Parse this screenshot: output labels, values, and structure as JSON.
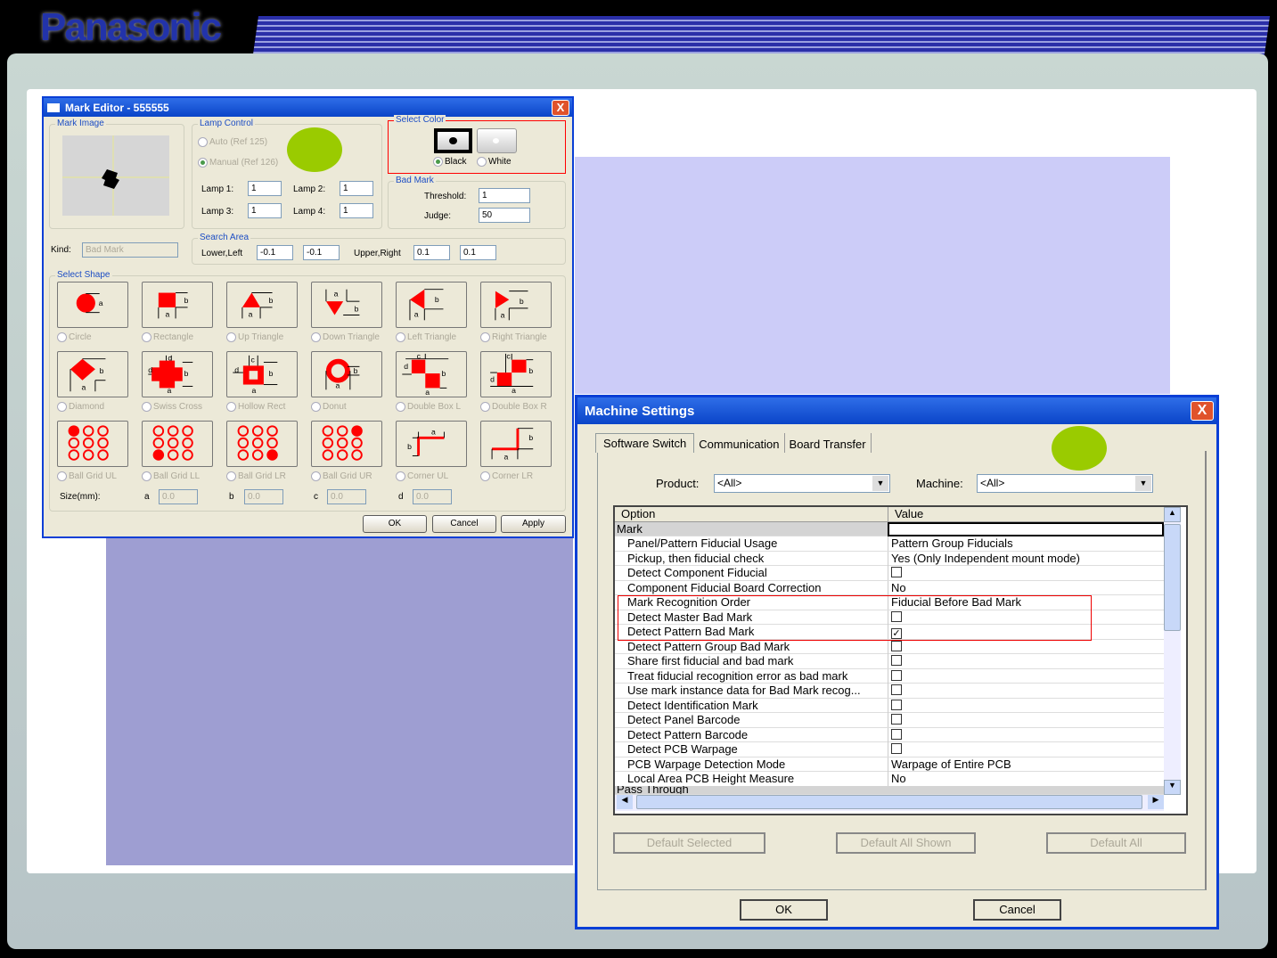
{
  "brand": "Panasonic",
  "mark_editor": {
    "title": "Mark Editor - 555555",
    "close": "X",
    "mark_image_label": "Mark Image",
    "lamp_control": {
      "label": "Lamp Control",
      "auto": "Auto (Ref 125)",
      "manual": "Manual (Ref 126)",
      "lamps": [
        {
          "label": "Lamp 1:",
          "value": "1"
        },
        {
          "label": "Lamp 2:",
          "value": "1"
        },
        {
          "label": "Lamp 3:",
          "value": "1"
        },
        {
          "label": "Lamp 4:",
          "value": "1"
        }
      ]
    },
    "select_color": {
      "label": "Select Color",
      "black": "Black",
      "white": "White",
      "selected": "Black"
    },
    "bad_mark": {
      "label": "Bad Mark",
      "threshold_label": "Threshold:",
      "threshold": "1",
      "judge_label": "Judge:",
      "judge": "50"
    },
    "kind_label": "Kind:",
    "kind_value": "Bad Mark",
    "search_area": {
      "label": "Search Area",
      "lower_left_label": "Lower,Left",
      "ll1": "-0.1",
      "ll2": "-0.1",
      "upper_right_label": "Upper,Right",
      "ur1": "0.1",
      "ur2": "0.1"
    },
    "select_shape_label": "Select Shape",
    "shapes": [
      {
        "label": "Circle",
        "icon": "circle"
      },
      {
        "label": "Rectangle",
        "icon": "rect"
      },
      {
        "label": "Up Triangle",
        "icon": "uptri"
      },
      {
        "label": "Down Triangle",
        "icon": "downtri"
      },
      {
        "label": "Left Triangle",
        "icon": "lefttri"
      },
      {
        "label": "Right Triangle",
        "icon": "righttri"
      },
      {
        "label": "Diamond",
        "icon": "diamond"
      },
      {
        "label": "Swiss Cross",
        "icon": "cross"
      },
      {
        "label": "Hollow Rect",
        "icon": "hollow"
      },
      {
        "label": "Donut",
        "icon": "donut"
      },
      {
        "label": "Double Box L",
        "icon": "dboxl"
      },
      {
        "label": "Double Box R",
        "icon": "dboxr"
      },
      {
        "label": "Ball Grid UL",
        "icon": "bg0"
      },
      {
        "label": "Ball Grid LL",
        "icon": "bg6"
      },
      {
        "label": "Ball Grid LR",
        "icon": "bg8"
      },
      {
        "label": "Ball Grid UR",
        "icon": "bg2"
      },
      {
        "label": "Corner UL",
        "icon": "cornul"
      },
      {
        "label": "Corner LR",
        "icon": "cornlr"
      }
    ],
    "size": {
      "label": "Size(mm):",
      "a": "a",
      "b": "b",
      "c": "c",
      "d": "d",
      "a_val": "0.0",
      "b_val": "0.0",
      "c_val": "0.0",
      "d_val": "0.0"
    },
    "ok": "OK",
    "cancel": "Cancel",
    "apply": "Apply"
  },
  "machine_settings": {
    "title": "Machine Settings",
    "close": "X",
    "tabs": [
      "Software Switch",
      "Communication",
      "Board Transfer"
    ],
    "product_label": "Product:",
    "product": "<All>",
    "machine_label": "Machine:",
    "machine": "<All>",
    "col_option": "Option",
    "col_value": "Value",
    "group": "Mark",
    "rows": [
      {
        "option": "Panel/Pattern Fiducial Usage",
        "value": "Pattern Group Fiducials"
      },
      {
        "option": "Pickup, then fiducial check",
        "value": "Yes (Only Independent mount mode)"
      },
      {
        "option": "Detect Component Fiducial",
        "check": false
      },
      {
        "option": "Component Fiducial Board Correction",
        "value": "No"
      },
      {
        "option": "Mark Recognition Order",
        "value": "Fiducial Before Bad Mark"
      },
      {
        "option": "Detect Master Bad Mark",
        "check": false
      },
      {
        "option": "Detect Pattern Bad Mark",
        "check": true
      },
      {
        "option": "Detect Pattern Group Bad Mark",
        "check": false
      },
      {
        "option": "Share first fiducial and bad mark",
        "check": false
      },
      {
        "option": "Treat fiducial recognition error as bad mark",
        "check": false
      },
      {
        "option": "Use mark instance data for Bad Mark recog...",
        "check": false
      },
      {
        "option": "Detect Identification Mark",
        "check": false
      },
      {
        "option": "Detect Panel Barcode",
        "check": false
      },
      {
        "option": "Detect Pattern Barcode",
        "check": false
      },
      {
        "option": "Detect PCB Warpage",
        "check": false
      },
      {
        "option": "PCB Warpage Detection Mode",
        "value": "Warpage of Entire PCB"
      },
      {
        "option": "Local Area PCB Height Measure",
        "value": "No"
      }
    ],
    "next_group": "Pass Through",
    "default_selected": "Default Selected",
    "default_all_shown": "Default All Shown",
    "default_all": "Default All",
    "ok": "OK",
    "cancel": "Cancel"
  },
  "colors": {
    "highlight_dot": "#9acb00",
    "title_blue": "#0a44c8",
    "shape_red": "#ff0000"
  }
}
